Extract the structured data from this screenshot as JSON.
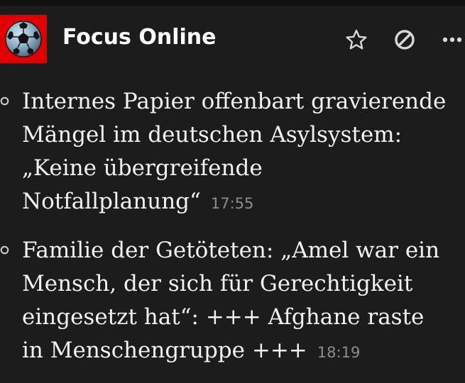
{
  "feed": {
    "title": "Focus Online",
    "logo_icon": "soccer-ball-icon",
    "logo_color": "#e00000"
  },
  "actions": [
    {
      "icon": "star-icon",
      "label": "favorite"
    },
    {
      "icon": "block-icon",
      "label": "block"
    },
    {
      "icon": "more-icon",
      "label": "more"
    }
  ],
  "articles": [
    {
      "headline": "Internes Papier offenbart gravierende Mängel im deutschen Asylsystem: „Keine übergreifende Notfallplanung“",
      "time": "17:55"
    },
    {
      "headline": "Familie der Getöteten: „Amel war ein Mensch, der sich für Gerechtigkeit eingesetzt hat“: +++ Afghane raste in Menschengruppe +++",
      "time": "18:19"
    }
  ],
  "colors": {
    "background": "#1c1c1c",
    "text": "#f2f2f2",
    "time": "#8c8c8c",
    "icons": "#d8d8d8"
  }
}
